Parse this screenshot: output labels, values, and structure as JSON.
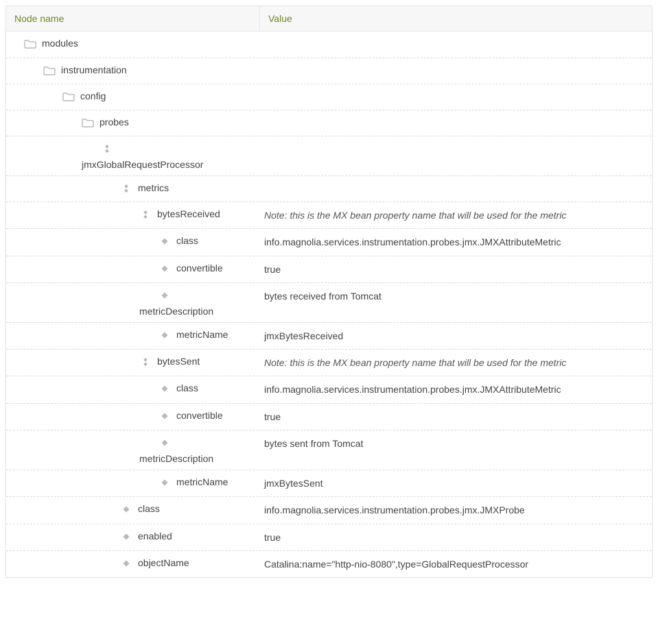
{
  "header": {
    "name": "Node name",
    "value": "Value"
  },
  "rows": [
    {
      "indent": 0,
      "icon": "folder",
      "name": "modules",
      "value": ""
    },
    {
      "indent": 1,
      "icon": "folder",
      "name": "instrumentation",
      "value": ""
    },
    {
      "indent": 2,
      "icon": "folder",
      "name": "config",
      "value": ""
    },
    {
      "indent": 3,
      "icon": "folder",
      "name": "probes",
      "value": ""
    },
    {
      "indent": 4,
      "icon": "node",
      "name": "jmxGlobalRequestProcessor",
      "value": "",
      "nameBelow": true
    },
    {
      "indent": 5,
      "icon": "node",
      "name": "metrics",
      "value": ""
    },
    {
      "indent": 6,
      "icon": "node",
      "name": "bytesReceived",
      "value": "Note: this is the MX bean property name that will be used for the metric",
      "italic": true
    },
    {
      "indent": 7,
      "icon": "prop",
      "name": "class",
      "value": "info.magnolia.services.instrumentation.probes.jmx.JMXAttributeMetric"
    },
    {
      "indent": 7,
      "icon": "prop",
      "name": "convertible",
      "value": "true"
    },
    {
      "indent": 7,
      "icon": "prop",
      "name": "metricDescription",
      "value": "bytes received from Tomcat",
      "nameBelow": true
    },
    {
      "indent": 7,
      "icon": "prop",
      "name": "metricName",
      "value": "jmxBytesReceived"
    },
    {
      "indent": 6,
      "icon": "node",
      "name": "bytesSent",
      "value": "Note: this is the MX bean property name that will be used for the metric",
      "italic": true
    },
    {
      "indent": 7,
      "icon": "prop",
      "name": "class",
      "value": "info.magnolia.services.instrumentation.probes.jmx.JMXAttributeMetric"
    },
    {
      "indent": 7,
      "icon": "prop",
      "name": "convertible",
      "value": "true"
    },
    {
      "indent": 7,
      "icon": "prop",
      "name": "metricDescription",
      "value": "bytes sent from Tomcat",
      "nameBelow": true
    },
    {
      "indent": 7,
      "icon": "prop",
      "name": "metricName",
      "value": "jmxBytesSent"
    },
    {
      "indent": 5,
      "icon": "prop",
      "name": "class",
      "value": "info.magnolia.services.instrumentation.probes.jmx.JMXProbe"
    },
    {
      "indent": 5,
      "icon": "prop",
      "name": "enabled",
      "value": "true"
    },
    {
      "indent": 5,
      "icon": "prop",
      "name": "objectName",
      "value": "Catalina:name=\"http-nio-8080\",type=GlobalRequestProcessor"
    }
  ]
}
